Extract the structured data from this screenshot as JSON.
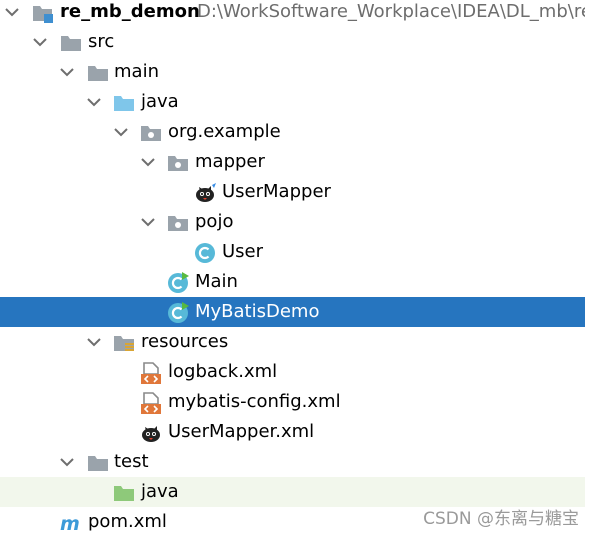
{
  "project": {
    "name": "re_mb_demon",
    "path": "D:\\WorkSoftware_Workplace\\IDEA\\DL_mb\\re_"
  },
  "tree": {
    "src": "src",
    "main": "main",
    "java": "java",
    "package": "org.example",
    "mapper": "mapper",
    "user_mapper": "UserMapper",
    "pojo": "pojo",
    "user": "User",
    "main_class": "Main",
    "mybatis_demo": "MyBatisDemo",
    "resources": "resources",
    "logback": "logback.xml",
    "mybatis_config": "mybatis-config.xml",
    "user_mapper_xml": "UserMapper.xml",
    "test": "test",
    "test_java": "java",
    "pom": "pom.xml"
  },
  "watermark": "CSDN @东离与糖宝",
  "colors": {
    "selection": "#2675bf",
    "test_row_bg": "#f2f7ec",
    "source_folder": "#7fc6ea",
    "test_folder": "#8ec97a",
    "plain_folder": "#9aa3ab",
    "class_icon": "#57b9d8",
    "main_marker": "#58b940",
    "xml_icon": "#e0773a"
  },
  "icons": {
    "module": "module-icon",
    "folder": "folder-icon",
    "source_folder": "source-folder-icon",
    "package": "package-icon",
    "class": "class-icon",
    "main_class": "runnable-class-icon",
    "mapper_interface": "mybatis-bird-icon",
    "resources_folder": "resources-folder-icon",
    "xml_file": "xml-file-icon",
    "test_folder": "test-folder-icon",
    "maven": "maven-icon",
    "expand": "chevron-down-icon"
  }
}
